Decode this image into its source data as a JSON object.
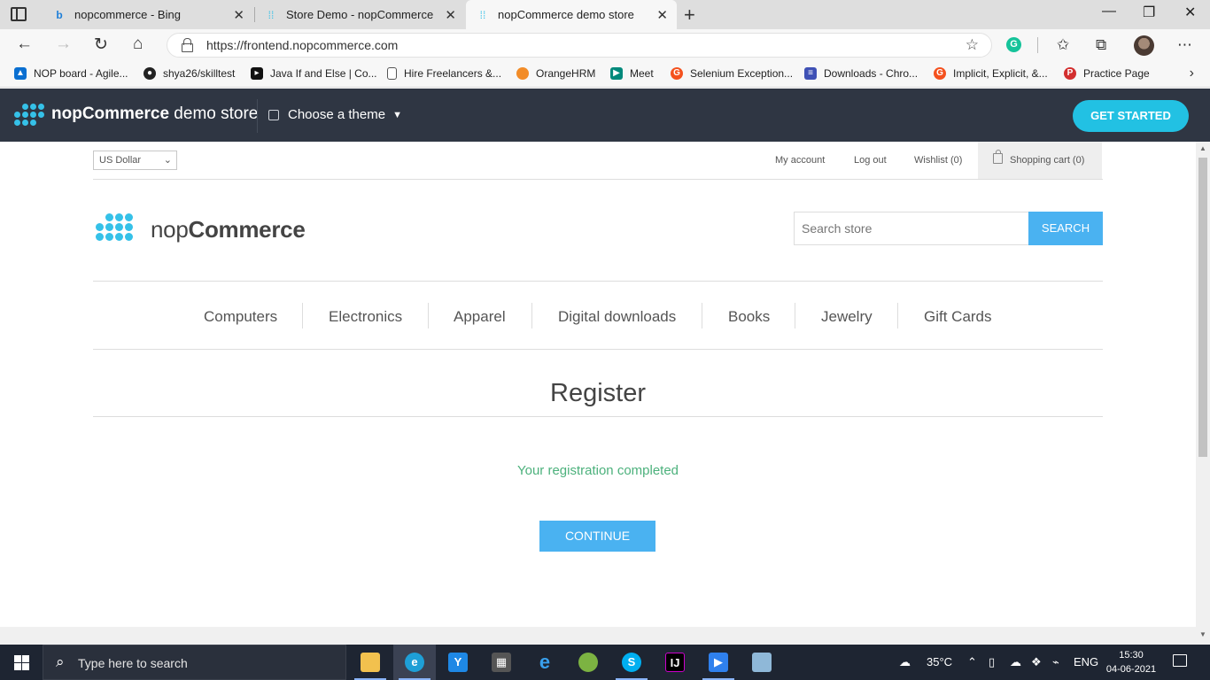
{
  "browser": {
    "tabs": [
      {
        "title": "nopcommerce - Bing",
        "icon": "bing-icon"
      },
      {
        "title": "Store Demo - nopCommerce",
        "icon": "nopcommerce-icon"
      },
      {
        "title": "nopCommerce demo store",
        "icon": "nopcommerce-icon",
        "active": true
      }
    ],
    "url": "https://frontend.nopcommerce.com",
    "bookmarks": [
      {
        "label": "NOP board - Agile...",
        "icon": "azure-devops-icon",
        "color": "#0a6fd1"
      },
      {
        "label": "shya26/skilltest",
        "icon": "github-icon",
        "color": "#222222"
      },
      {
        "label": "Java If and Else | Co...",
        "icon": "codecademy-icon",
        "color": "#111111"
      },
      {
        "label": "Hire Freelancers &...",
        "icon": "page-icon",
        "color": "#ffffff"
      },
      {
        "label": "OrangeHRM",
        "icon": "orangehrm-icon",
        "color": "#f28c28"
      },
      {
        "label": "Meet",
        "icon": "google-meet-icon",
        "color": "#00897b"
      },
      {
        "label": "Selenium Exception...",
        "icon": "selenium-icon",
        "color": "#f4511e"
      },
      {
        "label": "Downloads - Chro...",
        "icon": "chrome-downloads-icon",
        "color": "#3f51b5"
      },
      {
        "label": "Implicit, Explicit, &...",
        "icon": "selenium-icon",
        "color": "#f4511e"
      },
      {
        "label": "Practice Page",
        "icon": "practice-icon",
        "color": "#d32f2f"
      }
    ]
  },
  "demobar": {
    "brand_bold": "nopCommerce",
    "brand_rest": " demo store",
    "theme_label": "Choose a theme",
    "cta": "GET STARTED"
  },
  "store": {
    "currency": "US Dollar",
    "links": {
      "my_account": "My account",
      "logout": "Log out",
      "wishlist": "Wishlist (0)",
      "cart": "Shopping cart (0)"
    },
    "logo": {
      "light": "nop",
      "bold": "Commerce"
    },
    "search": {
      "placeholder": "Search store",
      "button": "SEARCH"
    },
    "menu": [
      "Computers",
      "Electronics",
      "Apparel",
      "Digital downloads",
      "Books",
      "Jewelry",
      "Gift Cards"
    ],
    "page_title": "Register",
    "result": "Your registration completed",
    "continue": "CONTINUE",
    "colors": {
      "accent": "#4ab2f1",
      "success": "#4cb17c",
      "header": "#2f3643",
      "cta": "#22c1e3"
    }
  },
  "taskbar": {
    "search_placeholder": "Type here to search",
    "weather": "35°C",
    "language": "ENG",
    "time": "15:30",
    "date": "04-06-2021"
  }
}
